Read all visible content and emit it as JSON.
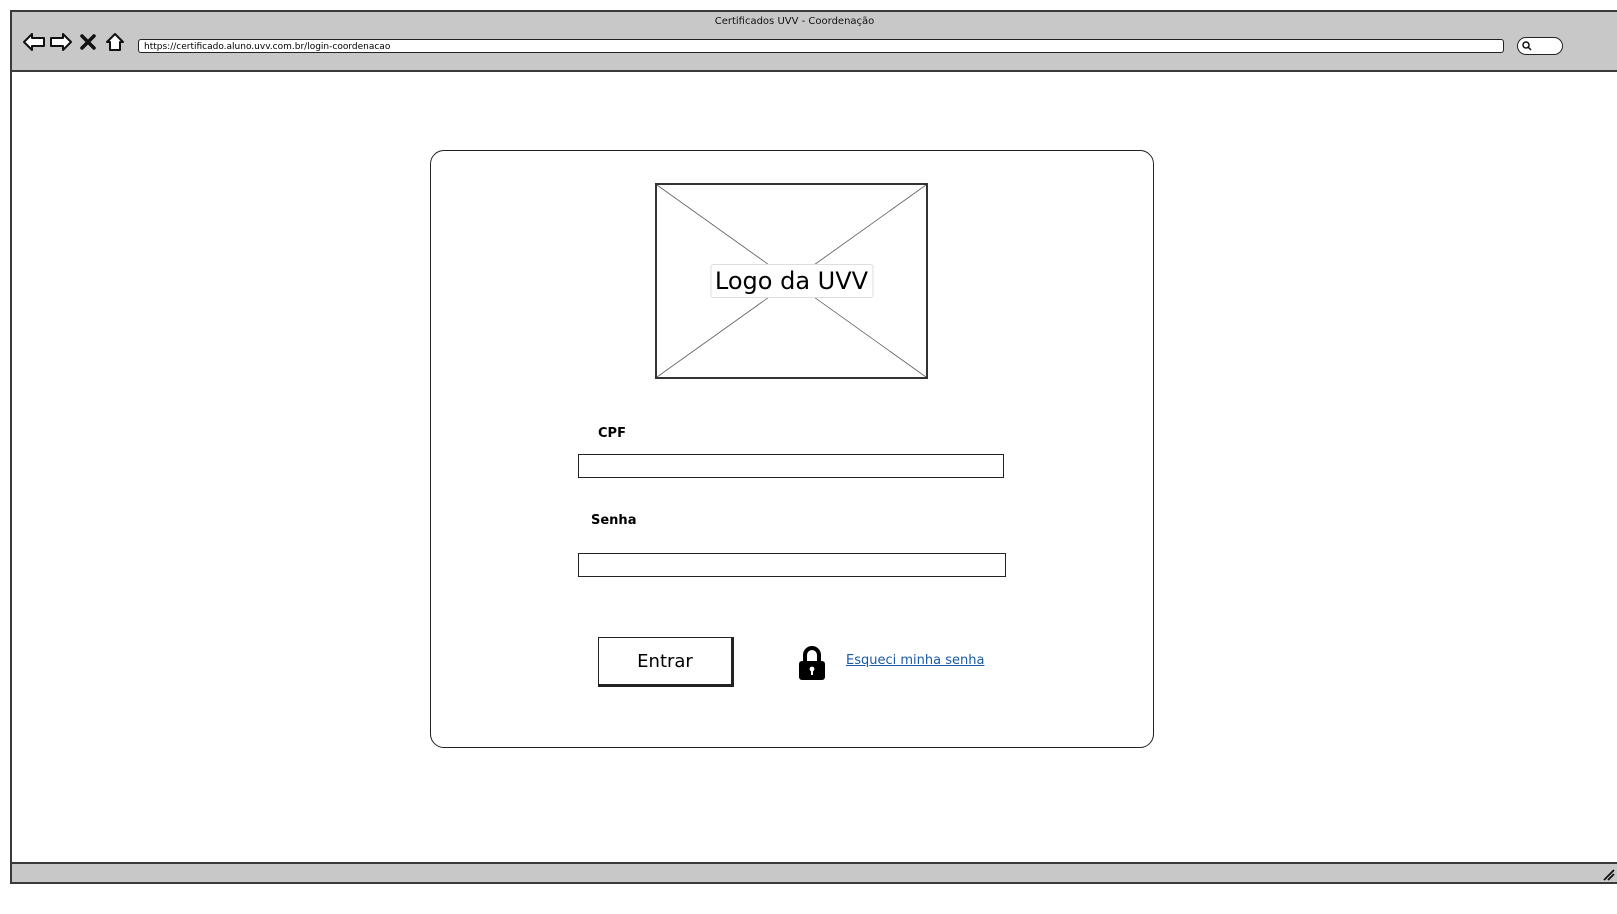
{
  "window": {
    "title": "Certificados UVV - Coordenação"
  },
  "toolbar": {
    "url": "https://certificado.aluno.uvv.com.br/login-coordenacao"
  },
  "icons": {
    "back": "arrow-left-icon",
    "forward": "arrow-right-icon",
    "stop": "close-icon",
    "home": "home-icon",
    "search": "search-icon",
    "lock": "lock-icon",
    "resize": "resize-grip-icon"
  },
  "login": {
    "logo_label": "Logo da UVV",
    "cpf_label": "CPF",
    "cpf_value": "",
    "password_label": "Senha",
    "password_value": "",
    "submit_label": "Entrar",
    "forgot_label": "Esqueci minha senha"
  },
  "colors": {
    "chrome": "#c8c8c8",
    "link": "#1a5aa8",
    "border": "#222222"
  }
}
